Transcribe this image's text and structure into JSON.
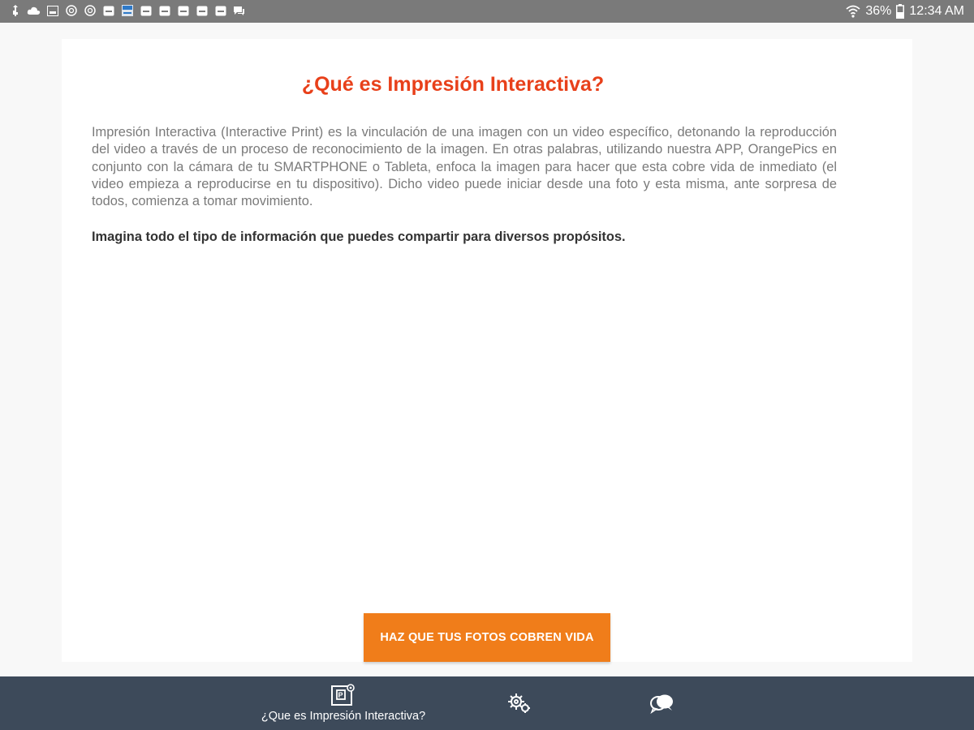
{
  "status_bar": {
    "notification_icons": [
      "usb-icon",
      "cloud-upload-icon",
      "photo-icon",
      "instagram-icon",
      "instagram-icon",
      "email-icon",
      "app-icon",
      "email-icon",
      "email-icon",
      "email-icon",
      "email-icon",
      "email-icon",
      "messages-icon"
    ],
    "battery": "36%",
    "time": "12:34 AM"
  },
  "content": {
    "title": "¿Qué es Impresión Interactiva?",
    "description": "Impresión Interactiva (Interactive Print) es la vinculación de una imagen con un video específico, detonando la reproducción del video a través de un proceso de reconocimiento de la imagen. En otras palabras, utilizando nuestra APP, OrangePics en conjunto con la cámara de tu SMARTPHONE o Tableta, enfoca la imagen para hacer que esta cobre vida de inmediato (el video empieza a reproducirse en tu dispositivo). Dicho video puede iniciar desde una foto y esta misma, ante sorpresa de todos, comienza a tomar movimiento.",
    "tagline": "Imagina todo el tipo de información que puedes compartir para diversos propósitos.",
    "cta_label": "HAZ QUE TUS FOTOS COBREN VIDA"
  },
  "bottom_nav": {
    "items": [
      {
        "label": "¿Que es Impresión Interactiva?",
        "icon": "interactive-print-icon",
        "selected": true
      },
      {
        "label": "",
        "icon": "settings-gears-icon",
        "selected": false
      },
      {
        "label": "",
        "icon": "chat-bubbles-icon",
        "selected": false
      }
    ]
  },
  "colors": {
    "status_bar": "#7a7a7a",
    "title": "#e8401a",
    "cta_button": "#f07d1a",
    "bottom_nav": "#3d4a5a"
  }
}
